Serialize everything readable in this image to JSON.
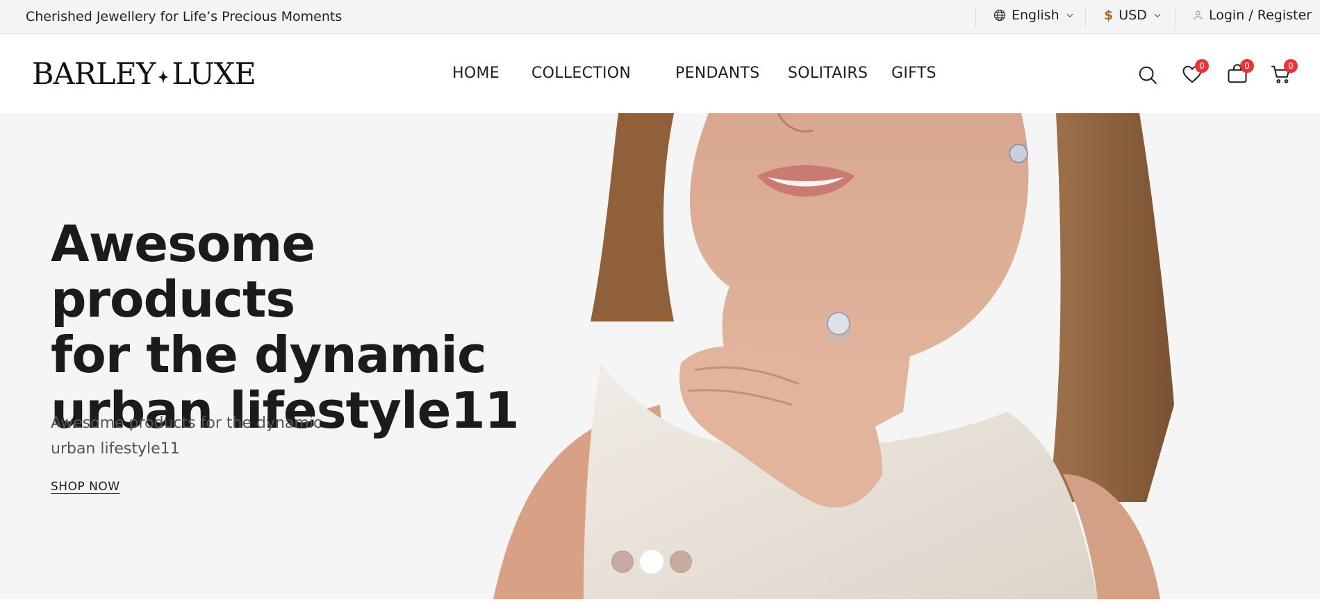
{
  "topbar": {
    "tagline": "Cherished Jewellery for Life’s Precious Moments",
    "language": "English",
    "currency_symbol": "$",
    "currency": "USD",
    "login": "Login / Register"
  },
  "header": {
    "logo_left": "BARLEY",
    "logo_right": "LUXE",
    "nav": [
      "HOME",
      "COLLECTION",
      "PENDANTS",
      "SOLITAIRS",
      "GIFTS"
    ],
    "wishlist_count": "0",
    "compare_count": "0",
    "cart_count": "0"
  },
  "hero": {
    "title_line1": "Awesome products",
    "title_line2": "for the dynamic",
    "title_line3": "urban lifestyle11",
    "subtitle": "Awesome products for the dynamic urban lifestyle11",
    "cta": "SHOP NOW",
    "slides": 3,
    "active_slide": 2
  },
  "colors": {
    "badge": "#e83434",
    "hero_bg": "#f5f5f5",
    "dot": "#c9aaa3"
  }
}
